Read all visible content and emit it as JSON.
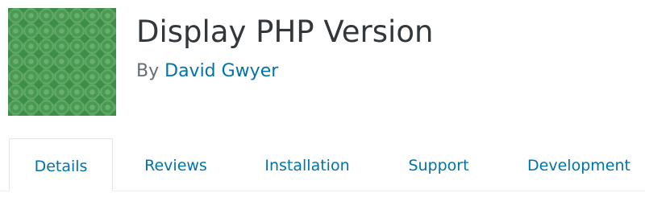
{
  "plugin": {
    "title": "Display PHP Version",
    "byline_prefix": "By",
    "author": "David Gwyer",
    "icon": "plugin-banner-icon"
  },
  "tabs": [
    {
      "label": "Details",
      "active": true
    },
    {
      "label": "Reviews",
      "active": false
    },
    {
      "label": "Installation",
      "active": false
    },
    {
      "label": "Support",
      "active": false
    },
    {
      "label": "Development",
      "active": false
    }
  ],
  "colors": {
    "icon_green": "#4a9b52",
    "link_blue": "#0073aa",
    "title_text": "#32373c",
    "muted_text": "#666d73"
  }
}
